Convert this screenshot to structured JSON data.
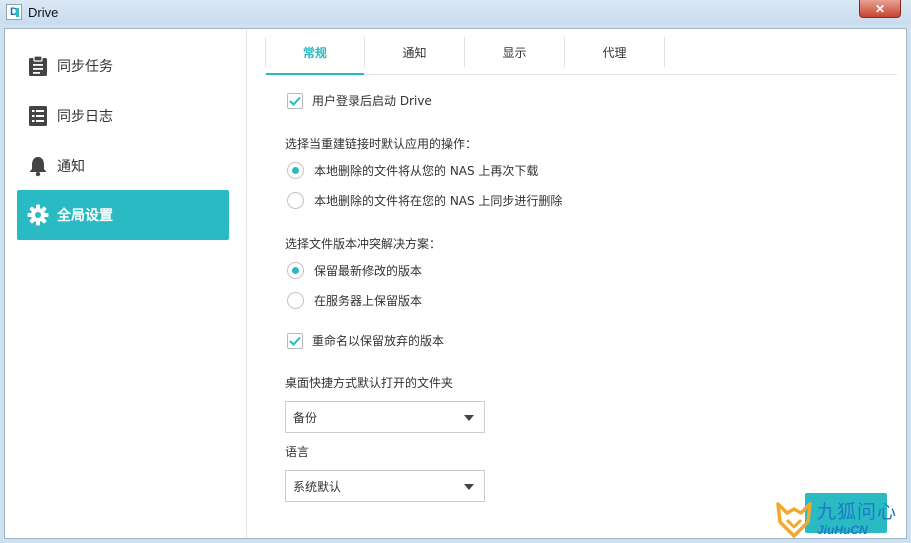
{
  "window": {
    "title": "Drive",
    "close_glyph": "✕"
  },
  "sidebar": {
    "items": [
      {
        "label": "同步任务",
        "icon": "clipboard-icon",
        "active": false
      },
      {
        "label": "同步日志",
        "icon": "log-list-icon",
        "active": false
      },
      {
        "label": "通知",
        "icon": "bell-icon",
        "active": false
      },
      {
        "label": "全局设置",
        "icon": "gear-icon",
        "active": true
      }
    ]
  },
  "tabs": [
    {
      "label": "常规",
      "active": true
    },
    {
      "label": "通知",
      "active": false
    },
    {
      "label": "显示",
      "active": false
    },
    {
      "label": "代理",
      "active": false
    }
  ],
  "general": {
    "launch_on_login": {
      "label": "用户登录后启动 Drive",
      "checked": true
    },
    "relink_title": "选择当重建链接时默认应用的操作：",
    "relink_options": [
      {
        "label": "本地删除的文件将从您的 NAS 上再次下载",
        "checked": true
      },
      {
        "label": "本地删除的文件将在您的 NAS 上同步进行删除",
        "checked": false
      }
    ],
    "conflict_title": "选择文件版本冲突解决方案：",
    "conflict_options": [
      {
        "label": "保留最新修改的版本",
        "checked": true
      },
      {
        "label": "在服务器上保留版本",
        "checked": false
      }
    ],
    "rename_keep": {
      "label": "重命名以保留放弃的版本",
      "checked": true
    },
    "shortcut_title": "桌面快捷方式默认打开的文件夹",
    "shortcut_value": "备份",
    "language_title": "语言",
    "language_value": "系统默认"
  },
  "watermark": {
    "text_cn": "九狐问心",
    "text_en": "JiuHuCN"
  },
  "colors": {
    "accent": "#29bac4",
    "watermark_blue": "#1b7cc4",
    "watermark_orange": "#f2a72e"
  }
}
